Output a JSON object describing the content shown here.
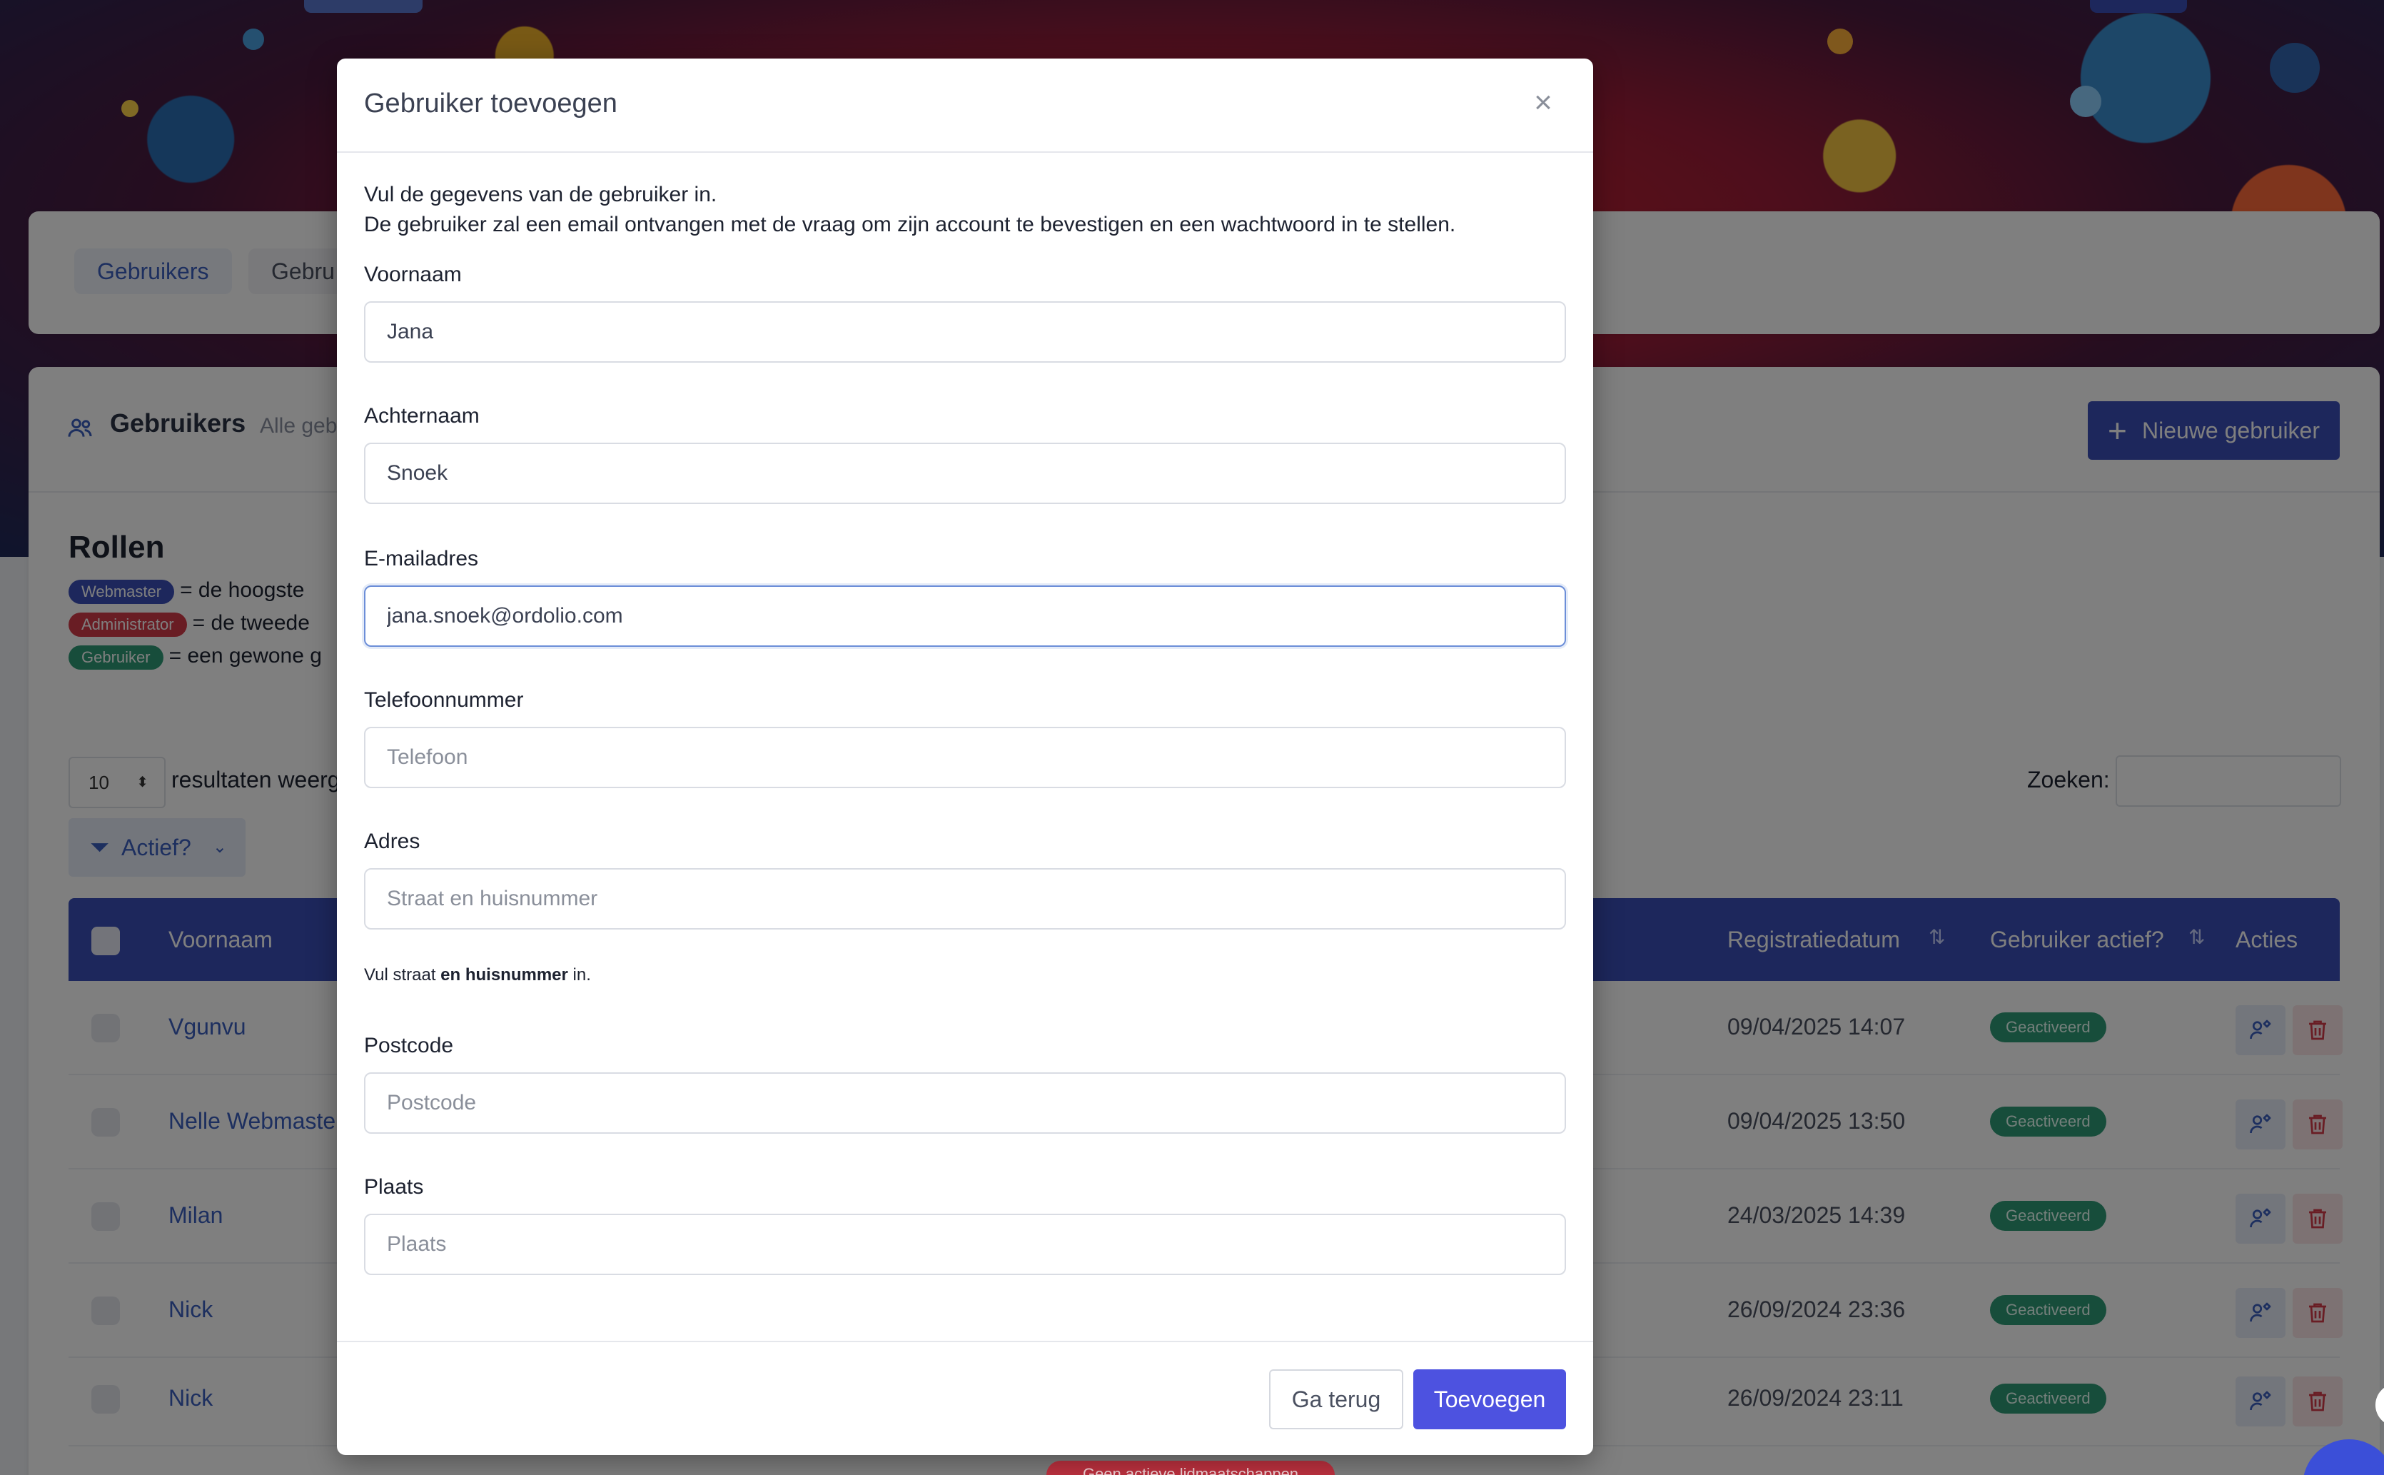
{
  "background": {
    "tabs": [
      "Gebruikers",
      "Gebru"
    ],
    "section_title": "Gebruikers",
    "section_subtitle": "Alle geb",
    "new_user_label": "Nieuwe gebruiker",
    "roles": {
      "title": "Rollen",
      "items": [
        {
          "badge": "Webmaster",
          "text": "= de hoogste"
        },
        {
          "badge": "Administrator",
          "text": "= de tweede"
        },
        {
          "badge": "Gebruiker",
          "text": "= een gewone g"
        }
      ]
    },
    "page_length": "10",
    "page_length_label": "resultaten weerg",
    "search_label": "Zoeken:",
    "filter_label": "Actief?",
    "table": {
      "columns": [
        "Voornaam",
        "Registratiedatum",
        "Gebruiker actief?",
        "Acties"
      ],
      "rows": [
        {
          "name": "Vgunvu",
          "date": "09/04/2025 14:07",
          "status": "Geactiveerd"
        },
        {
          "name": "Nelle Webmaster",
          "date": "09/04/2025 13:50",
          "status": "Geactiveerd"
        },
        {
          "name": "Milan",
          "date": "24/03/2025 14:39",
          "status": "Geactiveerd"
        },
        {
          "name": "Nick",
          "date": "26/09/2024 23:36",
          "status": "Geactiveerd"
        },
        {
          "name": "Nick",
          "date": "26/09/2024 23:11",
          "status": "Geactiveerd"
        }
      ],
      "peek_badge": "Geen actieve lidmaatschappen"
    }
  },
  "modal": {
    "title": "Gebruiker toevoegen",
    "intro_line1": "Vul de gegevens van de gebruiker in.",
    "intro_line2": "De gebruiker zal een email ontvangen met de vraag om zijn account te bevestigen en een wachtwoord in te stellen.",
    "fields": {
      "voornaam": {
        "label": "Voornaam",
        "value": "Jana",
        "placeholder": ""
      },
      "achternaam": {
        "label": "Achternaam",
        "value": "Snoek",
        "placeholder": ""
      },
      "email": {
        "label": "E-mailadres",
        "value": "jana.snoek@ordolio.com",
        "placeholder": ""
      },
      "telefoon": {
        "label": "Telefoonnummer",
        "value": "",
        "placeholder": "Telefoon"
      },
      "adres": {
        "label": "Adres",
        "value": "",
        "placeholder": "Straat en huisnummer"
      },
      "postcode": {
        "label": "Postcode",
        "value": "",
        "placeholder": "Postcode"
      },
      "plaats": {
        "label": "Plaats",
        "value": "",
        "placeholder": "Plaats"
      }
    },
    "address_hint_pre": "Vul straat ",
    "address_hint_bold": "en huisnummer",
    "address_hint_post": " in.",
    "back_label": "Ga terug",
    "submit_label": "Toevoegen"
  },
  "colors": {
    "primary": "#3b4fb8",
    "success": "#2f9a76",
    "danger": "#d33b48",
    "submit": "#4d52e0"
  }
}
